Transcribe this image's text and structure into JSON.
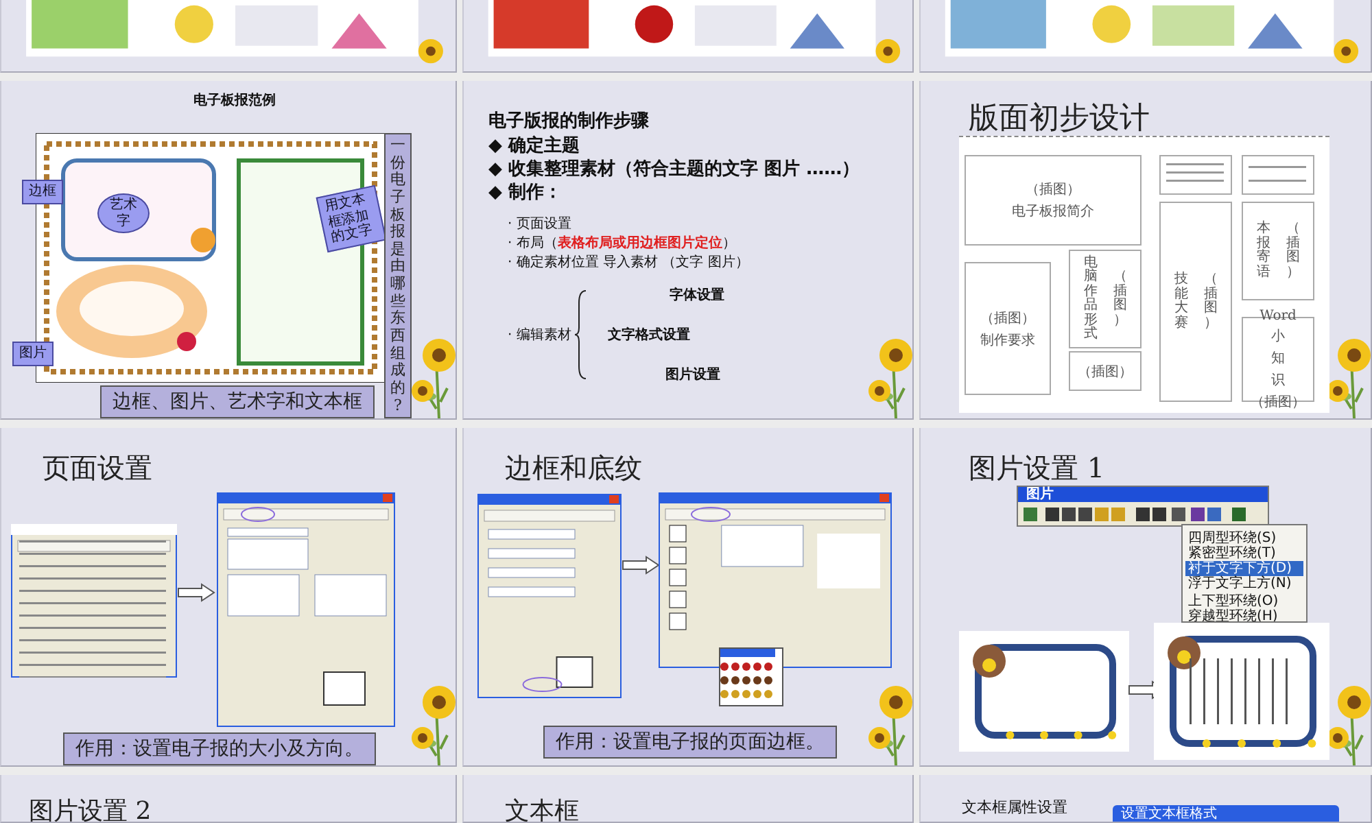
{
  "slides": [
    {
      "kind": "newspaper",
      "title": "电子板报范例",
      "callouts": [
        "边框",
        "艺术字",
        "用文本框添加的文字",
        "图片"
      ],
      "side_note": "一份电子板报是由哪些东西组成的?",
      "caption": "边框、图片、艺术字和文本框"
    },
    {
      "kind": "steps",
      "title": "电子版报的制作步骤",
      "marker": "◆",
      "bullets": [
        "确定主题",
        "收集整理素材（符合主题的文字  图片 ……）",
        "制作："
      ],
      "sub_marker": "·",
      "sub_items": [
        {
          "text": "页面设置"
        },
        {
          "text": "布局（",
          "highlight": "表格布局或用边框图片定位",
          "after": "）"
        },
        {
          "text": "确定素材位置 导入素材 （文字 图片）"
        }
      ],
      "edit_item": "编辑素材",
      "edit_options": [
        "字体设置",
        "文字格式设置",
        "图片设置"
      ]
    },
    {
      "kind": "layout",
      "title": "版面初步设计",
      "blocks": [
        {
          "lines": [
            "（插图）",
            "电子板报简介"
          ],
          "vertical": false
        },
        {
          "lines": [
            "（插图）",
            "制作要求"
          ],
          "vertical": false
        },
        {
          "lines": [
            "电脑作品形式",
            "（插图）"
          ],
          "vertical": true
        },
        {
          "lines": [
            "（插图）"
          ],
          "vertical": false
        },
        {
          "lines": [
            "技能大赛",
            "（插图）"
          ],
          "vertical": true
        },
        {
          "lines": [
            "本报寄语",
            "（插图）"
          ],
          "vertical": true
        },
        {
          "lines": [
            "Word",
            "小",
            "知",
            "识",
            "（插图）"
          ],
          "vertical": false
        }
      ]
    },
    {
      "kind": "page_setup",
      "title": "页面设置",
      "caption": "作用：设置电子报的大小及方向。"
    },
    {
      "kind": "border",
      "title": "边框和底纹",
      "caption": "作用：设置电子报的页面边框。"
    },
    {
      "kind": "wrap",
      "title": "图片设置 1",
      "toolbar_title": "图片",
      "menu": [
        {
          "label": "四周型环绕(S)",
          "selected": false
        },
        {
          "label": "紧密型环绕(T)",
          "selected": false
        },
        {
          "label": "衬于文字下方(D)",
          "selected": true
        },
        {
          "label": "浮于文字上方(N)",
          "selected": false
        },
        {
          "label": "上下型环绕(O)",
          "selected": false
        },
        {
          "label": "穿越型环绕(H)",
          "selected": false
        }
      ]
    },
    {
      "kind": "partial",
      "title": "图片设置 2"
    },
    {
      "kind": "partial",
      "title": "文本框"
    },
    {
      "kind": "partial_dialog",
      "title": "文本框属性设置",
      "dialog_title": "设置文本框格式"
    }
  ]
}
